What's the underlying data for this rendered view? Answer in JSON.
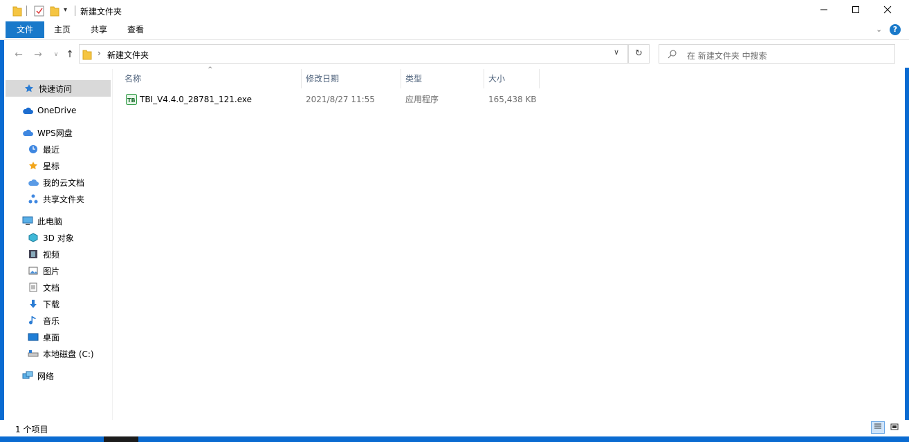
{
  "window": {
    "title": "新建文件夹",
    "minimize_icon": "minimize-icon",
    "maximize_icon": "maximize-icon",
    "close_icon": "close-icon"
  },
  "ribbon": {
    "tabs": [
      {
        "label": "文件"
      },
      {
        "label": "主页"
      },
      {
        "label": "共享"
      },
      {
        "label": "查看"
      }
    ]
  },
  "address": {
    "crumb": "新建文件夹",
    "separator": "›"
  },
  "search": {
    "placeholder": "在 新建文件夹 中搜索"
  },
  "sidebar": {
    "items": [
      {
        "label": "快速访问",
        "icon": "star-icon"
      },
      {
        "label": "OneDrive",
        "icon": "cloud-icon"
      },
      {
        "label": "WPS网盘",
        "icon": "wps-cloud-icon"
      },
      {
        "label": "最近",
        "icon": "clock-icon"
      },
      {
        "label": "星标",
        "icon": "star-icon"
      },
      {
        "label": "我的云文档",
        "icon": "cloud-docs-icon"
      },
      {
        "label": "共享文件夹",
        "icon": "share-icon"
      },
      {
        "label": "此电脑",
        "icon": "computer-icon"
      },
      {
        "label": "3D 对象",
        "icon": "cube-icon"
      },
      {
        "label": "视频",
        "icon": "video-icon"
      },
      {
        "label": "图片",
        "icon": "picture-icon"
      },
      {
        "label": "文档",
        "icon": "document-icon"
      },
      {
        "label": "下载",
        "icon": "download-icon"
      },
      {
        "label": "音乐",
        "icon": "music-icon"
      },
      {
        "label": "桌面",
        "icon": "desktop-icon"
      },
      {
        "label": "本地磁盘 (C:)",
        "icon": "disk-icon"
      },
      {
        "label": "网络",
        "icon": "network-icon"
      }
    ]
  },
  "columns": [
    {
      "label": "名称"
    },
    {
      "label": "修改日期"
    },
    {
      "label": "类型"
    },
    {
      "label": "大小"
    }
  ],
  "files": [
    {
      "name": "TBI_V4.4.0_28781_121.exe",
      "date": "2021/8/27 11:55",
      "type": "应用程序",
      "size": "165,438 KB"
    }
  ],
  "status": {
    "count": "1 个项目"
  },
  "colors": {
    "accent": "#1979ca",
    "border_blue": "#0a6bd1",
    "selected_bg": "#d9d9d9",
    "header_text": "#4c607a",
    "secondary_text": "#6d6d6d"
  }
}
